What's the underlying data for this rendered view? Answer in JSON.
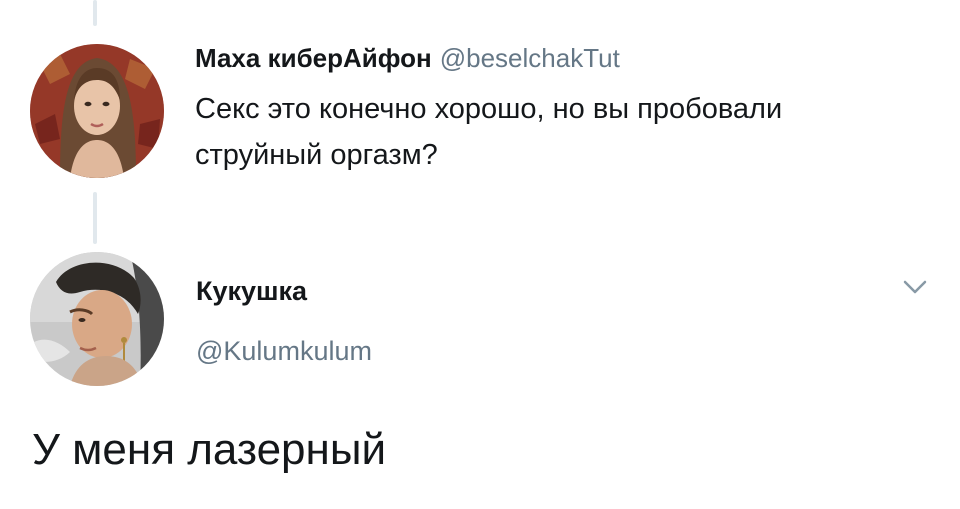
{
  "parent_tweet": {
    "display_name": "Маха киберАйфон",
    "handle": "@beselchakTut",
    "text": "Секс это конечно хорошо, но вы пробовали струйный оргазм?",
    "avatar": "avatar-woman-photo"
  },
  "reply_tweet": {
    "display_name": "Кукушка",
    "handle": "@Kulumkulum",
    "text": "У меня лазерный",
    "avatar": "avatar-person-photo",
    "menu_icon": "chevron-down-icon"
  },
  "colors": {
    "text_primary": "#14171a",
    "text_secondary": "#657786",
    "thread_line": "#e1e8ed"
  }
}
